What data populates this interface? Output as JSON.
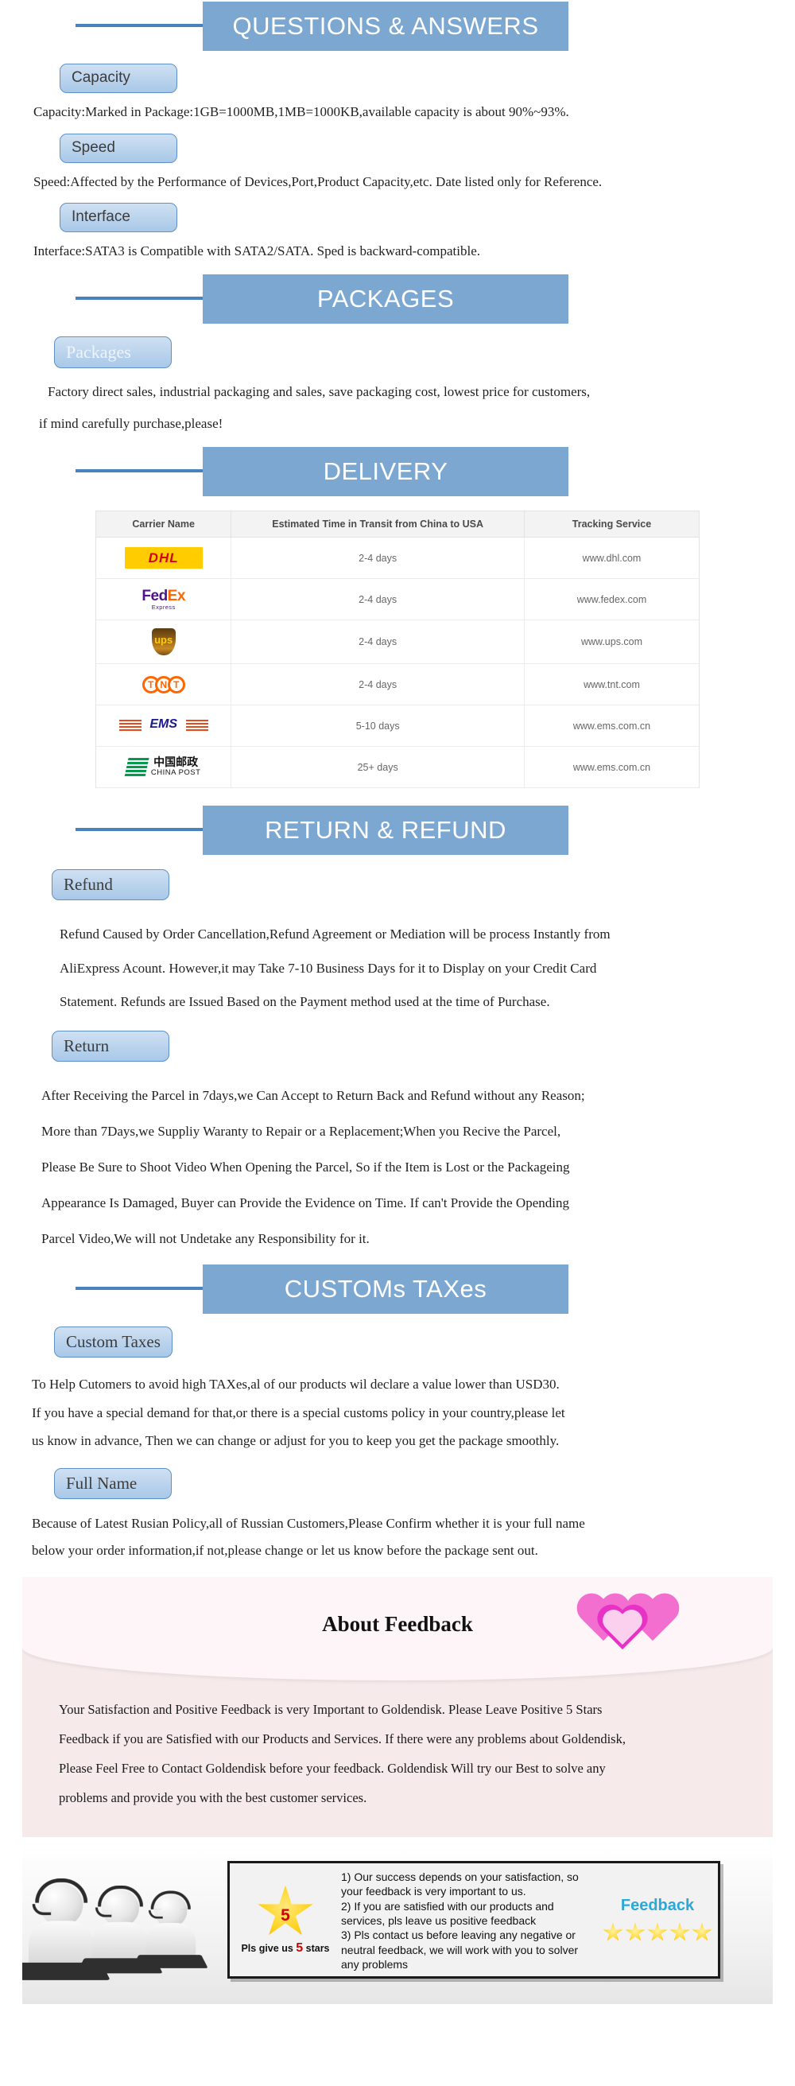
{
  "sections": {
    "qa": {
      "banner": "QUESTIONS & ANSWERS",
      "items": [
        {
          "label": "Capacity",
          "text": "Capacity:Marked in Package:1GB=1000MB,1MB=1000KB,available capacity is about 90%~93%."
        },
        {
          "label": "Speed",
          "text": "Speed:Affected by the Performance of Devices,Port,Product Capacity,etc. Date listed only for Reference."
        },
        {
          "label": "Interface",
          "text": "Interface:SATA3 is Compatible with SATA2/SATA. Sped is backward-compatible."
        }
      ]
    },
    "packages": {
      "banner": "PACKAGES",
      "label": "Packages",
      "line1": "Factory direct sales, industrial packaging and sales, save packaging cost, lowest price for customers,",
      "line2": "if mind carefully purchase,please!"
    },
    "delivery": {
      "banner": "DELIVERY",
      "columns": [
        "Carrier Name",
        "Estimated Time in Transit from China to USA",
        "Tracking Service"
      ],
      "rows": [
        {
          "carrier": "DHL",
          "logo": "dhl-logo",
          "time": "2-4 days",
          "tracking": "www.dhl.com"
        },
        {
          "carrier": "FedEx Express",
          "logo": "fedex-logo",
          "time": "2-4 days",
          "tracking": "www.fedex.com"
        },
        {
          "carrier": "UPS",
          "logo": "ups-logo",
          "time": "2-4 days",
          "tracking": "www.ups.com"
        },
        {
          "carrier": "TNT",
          "logo": "tnt-logo",
          "time": "2-4 days",
          "tracking": "www.tnt.com"
        },
        {
          "carrier": "EMS",
          "logo": "ems-logo",
          "time": "5-10 days",
          "tracking": "www.ems.com.cn"
        },
        {
          "carrier": "China Post",
          "logo": "china-post-logo",
          "time": "25+ days",
          "tracking": "www.ems.com.cn"
        }
      ],
      "logos": {
        "dhl": "DHL",
        "fedex_main": "FedEx",
        "fedex_fed": "Fed",
        "fedex_ex": "Ex",
        "fedex_sub": "Express",
        "ups": "ups",
        "tnt_t1": "T",
        "tnt_n": "N",
        "tnt_t2": "T",
        "ems": "EMS",
        "china_post_cn": "中国邮政",
        "china_post_en": "CHINA POST"
      }
    },
    "return_refund": {
      "banner": "RETURN & REFUND",
      "refund_label": "Refund",
      "refund_lines": [
        "Refund Caused by Order Cancellation,Refund Agreement or Mediation will be process Instantly from",
        "AliExpress Acount. However,it may Take 7-10 Business Days for it to Display on your Credit Card",
        "Statement. Refunds are Issued Based on the Payment method used at the time of Purchase."
      ],
      "return_label": "Return",
      "return_lines": [
        "After Receiving the Parcel in 7days,we Can Accept to Return Back and Refund without any Reason;",
        "More than 7Days,we Suppliy Waranty to Repair or a Replacement;When you Recive the Parcel,",
        "Please Be Sure to Shoot Video When Opening  the Parcel, So if the Item is Lost or the Packageing",
        "Appearance Is Damaged, Buyer can Provide the Evidence on Time. If can't Provide the Opending",
        "Parcel Video,We will not Undetake any Responsibility for it."
      ]
    },
    "customs": {
      "banner": "CUSTOMs TAXes",
      "custom_taxes_label": "Custom Taxes",
      "custom_taxes_lines": [
        "To Help Cutomers to avoid high TAXes,al of our products wil declare a value lower than USD30.",
        "If you have a special demand for that,or there is a special customs policy in your country,please let",
        "us know in advance, Then we can change or adjust for you to keep you get the package smoothly."
      ],
      "full_name_label": "Full Name",
      "full_name_lines": [
        "Because of Latest Rusian Policy,all of Russian Customers,Please Confirm whether it is your full name",
        "below your order information,if not,please change or let us know before the package sent out."
      ]
    },
    "feedback": {
      "title": "About Feedback",
      "lines": [
        "Your Satisfaction and Positive Feedback is very Important to Goldendisk. Please Leave Positive 5 Stars",
        "Feedback if you are Satisfied with our Products and Services. If there were any problems about Goldendisk,",
        "Please Feel Free to Contact Goldendisk before your feedback. Goldendisk Will try our Best to solve any",
        "problems and provide you with the best customer services."
      ]
    },
    "footer": {
      "star_number": "5",
      "star_caption_pre": "Pls give us ",
      "star_caption_num": "5",
      "star_caption_post": " stars",
      "points": [
        "1) Our success depends on your satisfaction, so",
        "your feedback is very important to us.",
        "2) If you are satisfied with our products and",
        "services, pls leave us positive feedback",
        "3) Pls contact us before leaving any negative or",
        "neutral feedback, we will work with you to solver",
        "any problems"
      ],
      "feedback_word": "Feedback",
      "star_count": 5
    }
  },
  "colors": {
    "banner_bar": "#7ba7d1",
    "banner_rule": "#4a82bd",
    "pill_border": "#5f91c4",
    "feedback_bg": "#f6eaea",
    "feedback_accent": "#2aa8d8",
    "star_gold": "#ffd21e",
    "star_red": "#d40000"
  }
}
